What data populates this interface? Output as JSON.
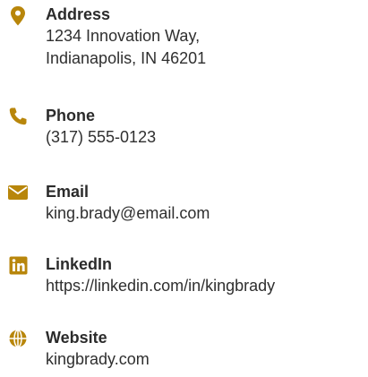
{
  "theme": {
    "accent": "#b8860b",
    "text": "#2b2b2b"
  },
  "contacts": [
    {
      "icon": "map-pin-icon",
      "label": "Address",
      "lines": [
        "1234 Innovation Way,",
        "Indianapolis, IN 46201"
      ]
    },
    {
      "icon": "phone-icon",
      "label": "Phone",
      "lines": [
        "(317) 555-0123"
      ]
    },
    {
      "icon": "envelope-icon",
      "label": "Email",
      "lines": [
        "king.brady@email.com"
      ]
    },
    {
      "icon": "linkedin-icon",
      "label": "LinkedIn",
      "lines": [
        "https://linkedin.com/in/kingbrady"
      ]
    },
    {
      "icon": "globe-icon",
      "label": "Website",
      "lines": [
        "kingbrady.com"
      ]
    }
  ]
}
